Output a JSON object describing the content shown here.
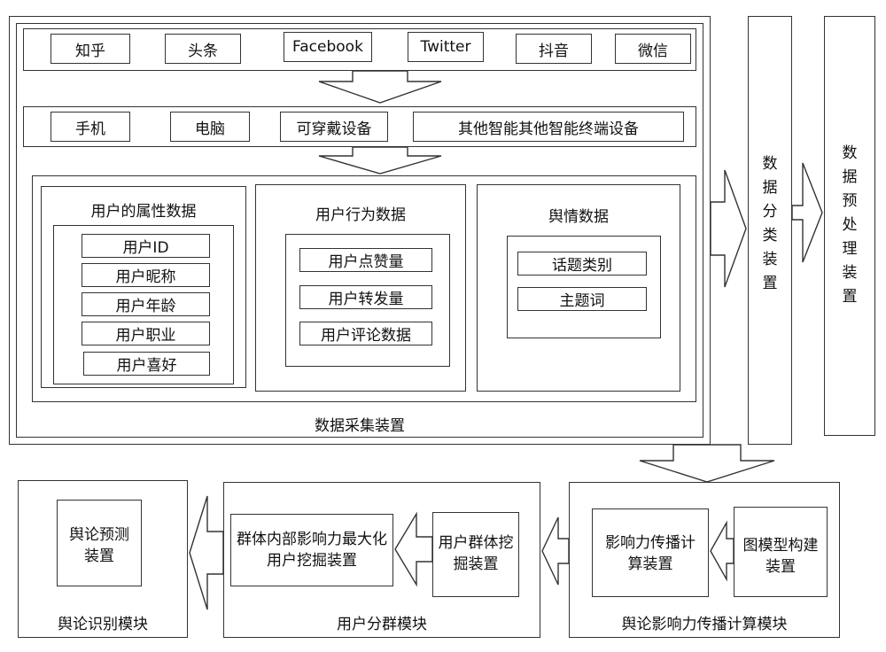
{
  "platforms": [
    "知乎",
    "头条",
    "Facebook",
    "Twitter",
    "抖音",
    "微信"
  ],
  "devices": [
    "手机",
    "电脑",
    "可穿戴设备",
    "其他智能其他智能终端设备"
  ],
  "attribute_group": {
    "title": "用户的属性数据",
    "items": [
      "用户ID",
      "用户昵称",
      "用户年龄",
      "用户职业",
      "用户喜好"
    ]
  },
  "behavior_group": {
    "title": "用户行为数据",
    "items": [
      "用户点赞量",
      "用户转发量",
      "用户评论数据"
    ]
  },
  "sentiment_group": {
    "title": "舆情数据",
    "items": [
      "话题类别",
      "主题词"
    ]
  },
  "collection_device": "数据采集装置",
  "classification_device": "数据分类装置",
  "preprocessing_device": "数据预处理装置",
  "propagation_module": {
    "title": "舆论影响力传播计算模块",
    "graph_model": "图模型构建装置",
    "influence_calc": "影响力传播计算装置"
  },
  "grouping_module": {
    "title": "用户分群模块",
    "group_mining": "用户群体挖掘装置",
    "max_influence": "群体内部影响力最大化用户挖掘装置"
  },
  "recognition_module": {
    "title": "舆论识别模块",
    "prediction": "舆论预测装置"
  }
}
